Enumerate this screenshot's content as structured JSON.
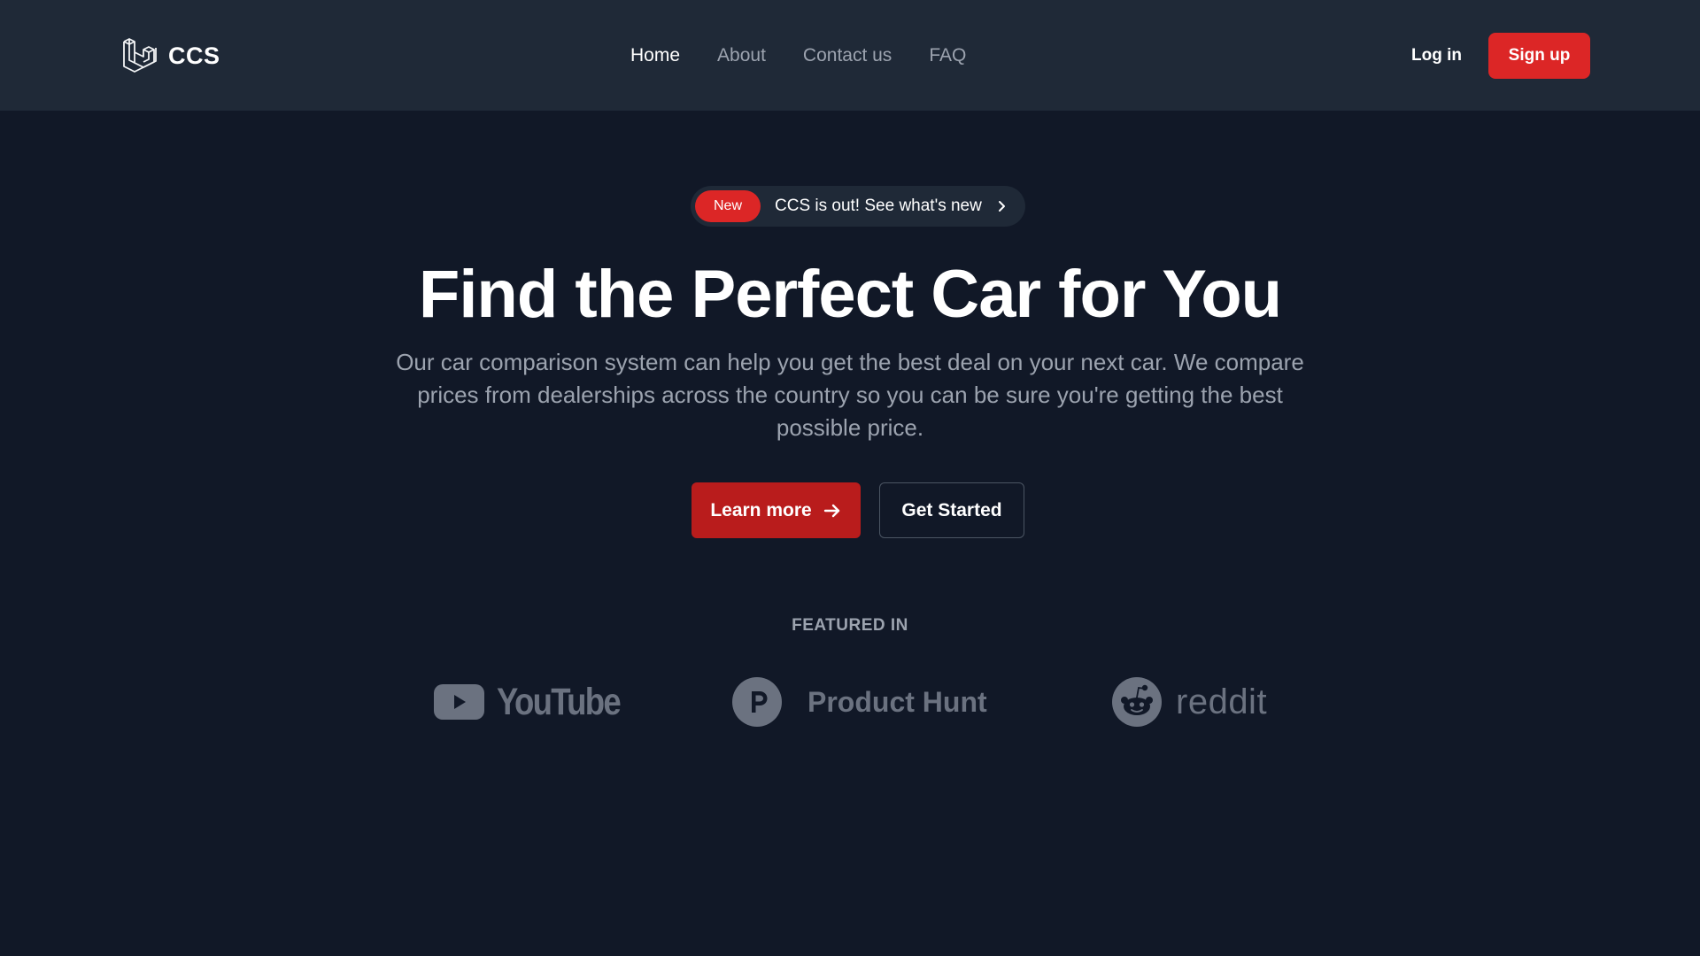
{
  "header": {
    "brand": {
      "name": "CCS",
      "icon": "stacked-cubes-icon"
    },
    "nav": [
      {
        "label": "Home",
        "active": true
      },
      {
        "label": "About",
        "active": false
      },
      {
        "label": "Contact us",
        "active": false
      },
      {
        "label": "FAQ",
        "active": false
      }
    ],
    "login_label": "Log in",
    "signup_label": "Sign up"
  },
  "hero": {
    "announcement": {
      "badge": "New",
      "text": "CCS is out! See what's new",
      "icon": "chevron-right-icon"
    },
    "headline": "Find the Perfect Car for You",
    "subtext": "Our car comparison system can help you get the best deal on your next car. We compare prices from dealerships across the country so you can be sure you're getting the best possible price.",
    "primary_button": {
      "label": "Learn more",
      "icon": "arrow-right-icon"
    },
    "secondary_button": {
      "label": "Get Started"
    }
  },
  "featured": {
    "label": "FEATURED IN",
    "logos": [
      {
        "name": "YouTube",
        "icon": "youtube-icon"
      },
      {
        "name": "Product Hunt",
        "icon": "product-hunt-icon"
      },
      {
        "name": "reddit",
        "icon": "reddit-icon"
      }
    ]
  },
  "colors": {
    "page_bg": "#111827",
    "header_bg": "#1f2937",
    "accent": "#dc2626",
    "accent_dark": "#b91c1c",
    "muted_text": "#9ca3af",
    "logo_gray": "#6b7280"
  }
}
